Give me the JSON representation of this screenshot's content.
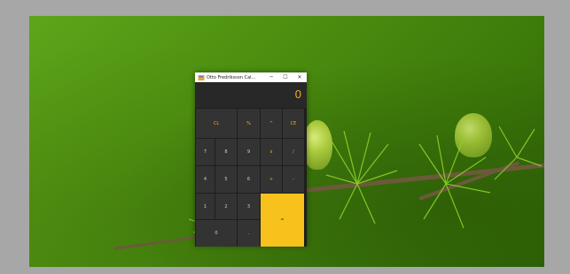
{
  "window": {
    "title": "Otto Fredriksson Cal...",
    "minimize_glyph": "─",
    "maximize_glyph": "☐",
    "close_glyph": "✕"
  },
  "display": {
    "value": "0"
  },
  "keys": {
    "clear": "CL",
    "percent": "%",
    "power": "^",
    "clear_entry": "CE",
    "seven": "7",
    "eight": "8",
    "nine": "9",
    "multiply": "x",
    "divide": "/",
    "four": "4",
    "five": "5",
    "six": "6",
    "add": "+",
    "subtract": "-",
    "one": "1",
    "two": "2",
    "three": "3",
    "equals": "=",
    "zero": "0",
    "decimal": "."
  },
  "colors": {
    "accent": "#f8c21c",
    "key_background": "#333333",
    "window_background": "#1e1e1e"
  }
}
